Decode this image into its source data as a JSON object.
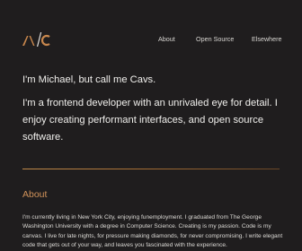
{
  "colors": {
    "background": "#1f1d1e",
    "accent": "#d1935a",
    "text": "#f0efec"
  },
  "header": {
    "logo_icon": "mc-monogram-logo",
    "nav": [
      {
        "label": "About"
      },
      {
        "label": "Open Source"
      },
      {
        "label": "Elsewhere"
      }
    ]
  },
  "intro": {
    "greeting": "I'm Michael, but call me Cavs.",
    "tagline": "I'm a frontend developer with an unrivaled eye for detail. I enjoy creating performant interfaces, and open source software."
  },
  "about": {
    "heading": "About",
    "body": "I'm currently living in New York City, enjoying funemployment. I graduated from The George Washington University with a degree in Computer Science. Creating is my passion. Code is my canvas. I live for late nights, for pressure making diamonds, for never compromising. I write elegant code that gets out of your way, and leaves you fascinated with the experience."
  }
}
